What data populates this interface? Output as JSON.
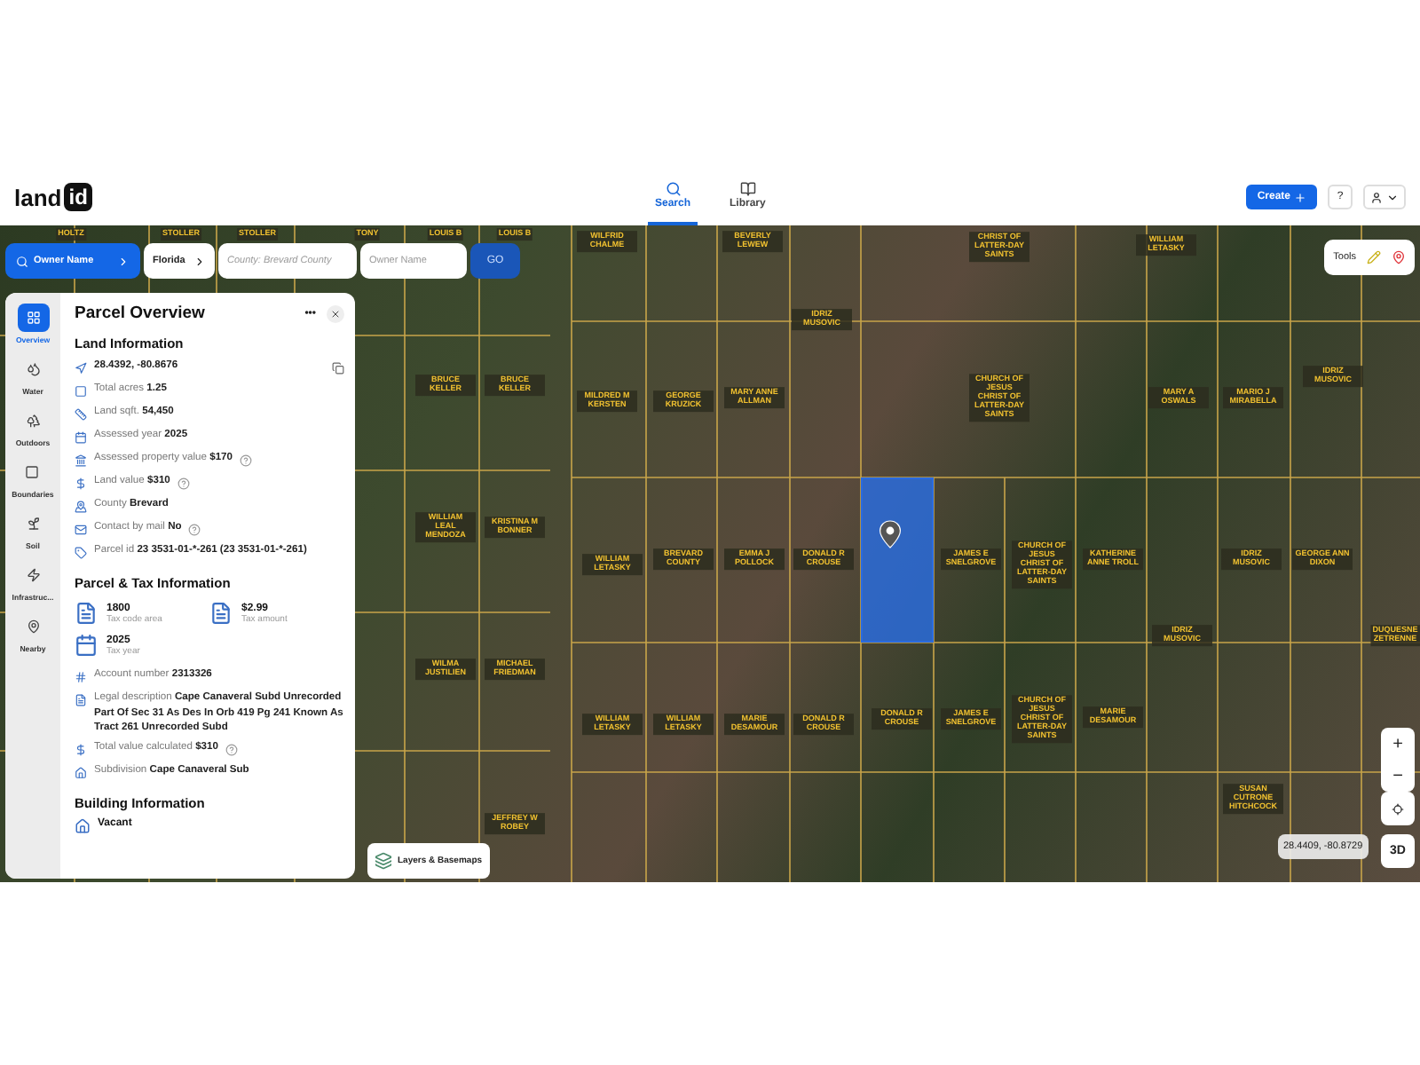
{
  "header": {
    "logo": {
      "word": "land",
      "badge": "id"
    },
    "tabs": [
      {
        "label": "Search",
        "selected": true
      },
      {
        "label": "Library",
        "selected": false
      }
    ],
    "create_button": "Create",
    "help_button": "?"
  },
  "search_bar": {
    "mode_button": "Owner Name",
    "state_select": "Florida",
    "county_field": {
      "placeholder": "County: Brevard County"
    },
    "owner_field": {
      "placeholder": "Owner Name"
    },
    "go_button": "GO"
  },
  "tools": {
    "label": "Tools"
  },
  "panel": {
    "title": "Parcel Overview",
    "more": "•••",
    "nav": [
      {
        "label": "Overview",
        "selected": true
      },
      {
        "label": "Water",
        "selected": false
      },
      {
        "label": "Outdoors",
        "selected": false
      },
      {
        "label": "Boundaries",
        "selected": false
      },
      {
        "label": "Soil",
        "selected": false
      },
      {
        "label": "Infrastruc...",
        "selected": false
      },
      {
        "label": "Nearby",
        "selected": false
      }
    ],
    "land_information": {
      "heading": "Land Information",
      "rows": [
        {
          "kind": "coords",
          "value": "28.4392, -80.8676"
        },
        {
          "kind": "row",
          "label": "Total acres",
          "value": "1.25",
          "help": false
        },
        {
          "kind": "row",
          "label": "Land sqft.",
          "value": "54,450",
          "help": false
        },
        {
          "kind": "row",
          "label": "Assessed year",
          "value": "2025",
          "help": false
        },
        {
          "kind": "row",
          "label": "Assessed property value",
          "value": "$170",
          "help": true
        },
        {
          "kind": "row",
          "label": "Land value",
          "value": "$310",
          "help": true
        },
        {
          "kind": "row",
          "label": "County",
          "value": "Brevard",
          "help": false
        },
        {
          "kind": "row",
          "label": "Contact by mail",
          "value": "No",
          "help": true
        },
        {
          "kind": "row",
          "label": "Parcel id",
          "value": "23 3531-01-*-261 (23 3531-01-*-261)",
          "help": false
        }
      ]
    },
    "tax_information": {
      "heading": "Parcel & Tax Information",
      "tiles": [
        {
          "value": "1800",
          "label": "Tax code area"
        },
        {
          "value": "$2.99",
          "label": "Tax amount"
        },
        {
          "value": "2025",
          "label": "Tax year"
        }
      ],
      "rows": [
        {
          "label": "Account number",
          "value": "2313326",
          "help": false
        },
        {
          "label": "Legal description",
          "value": "Cape Canaveral Subd Unrecorded Part Of Sec 31 As Des In Orb 419 Pg 241 Known As Tract 261 Unrecorded Subd",
          "help": false
        },
        {
          "label": "Total value calculated",
          "value": "$310",
          "help": true
        },
        {
          "label": "Subdivision",
          "value": "Cape Canaveral Sub",
          "help": false
        }
      ]
    },
    "building_information": {
      "heading": "Building Information",
      "value": "Vacant"
    }
  },
  "map": {
    "parcel_labels": [
      "HOLTZ",
      "STOLLER",
      "STOLLER",
      "TONY",
      "LOUIS B",
      "LOUIS B",
      "WILFRID CHALME",
      "BEVERLY LEWEW",
      "CHRIST OF LATTER-DAY SAINTS",
      "WILLIAM LETASKY",
      "IDRIZ MUSOVIC",
      "BRUCE KELLER",
      "BRUCE KELLER",
      "MILDRED M KERSTEN",
      "GEORGE KRUZICK",
      "MARY ANNE ALLMAN",
      "CHURCH OF JESUS CHRIST OF LATTER-DAY SAINTS",
      "MARY A OSWALS",
      "MARIO J MIRABELLA",
      "IDRIZ MUSOVIC",
      "WILLIAM LEAL MENDOZA",
      "KRISTINA M BONNER",
      "WILLIAM LETASKY",
      "BREVARD COUNTY",
      "EMMA J POLLOCK",
      "DONALD R CROUSE",
      "JAMES E SNELGROVE",
      "CHURCH OF JESUS CHRIST OF LATTER-DAY SAINTS",
      "KATHERINE ANNE TROLL",
      "IDRIZ MUSOVIC",
      "GEORGE ANN DIXON",
      "WILMA JUSTILIEN",
      "MICHAEL FRIEDMAN",
      "IDRIZ MUSOVIC",
      "DUQUESNE ZETRENNE",
      "WILLIAM LETASKY",
      "WILLIAM LETASKY",
      "MARIE DESAMOUR",
      "DONALD R CROUSE",
      "DONALD R CROUSE",
      "JAMES E SNELGROVE",
      "CHURCH OF JESUS CHRIST OF LATTER-DAY SAINTS",
      "MARIE DESAMOUR",
      "SUSAN CUTRONE HITCHCOCK",
      "JEFFREY W ROBEY"
    ],
    "layers_button": "Layers & Basemaps",
    "zoom_in": "+",
    "zoom_out": "−",
    "coordinates": "28.4409, -80.8729",
    "view_3d": "3D"
  }
}
